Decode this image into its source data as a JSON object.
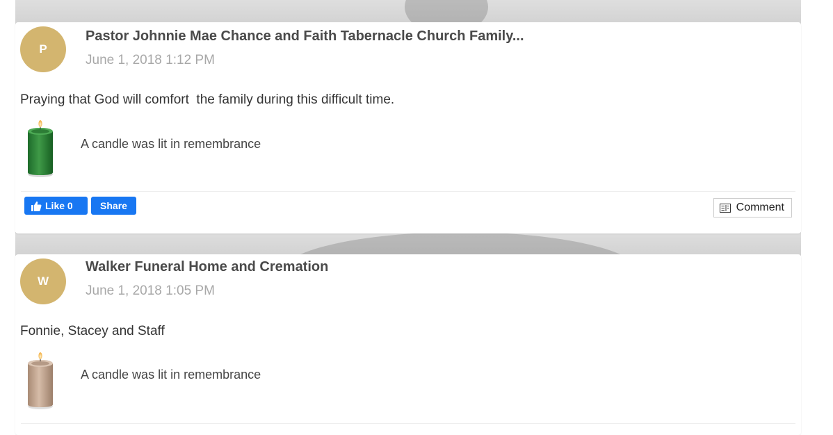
{
  "colors": {
    "avatar_bg": "#d3b56f",
    "facebook_blue": "#1877f2",
    "author_text": "#4a4a4a",
    "date_text": "#a8a8a8"
  },
  "posts": [
    {
      "avatar_initial": "P",
      "author": "Pastor Johnnie Mae Chance and Faith Tabernacle Church Family...",
      "date": "June 1, 2018 1:12 PM",
      "message": "Praying that God will comfort  the family during this difficult time.",
      "candle_color": "green",
      "candle_text": "A candle was lit in remembrance",
      "like_label": "Like 0",
      "share_label": "Share",
      "comment_label": "Comment"
    },
    {
      "avatar_initial": "W",
      "author": "Walker Funeral Home and Cremation",
      "date": "June 1, 2018 1:05 PM",
      "message": "Fonnie, Stacey and Staff",
      "candle_color": "beige",
      "candle_text": "A candle was lit in remembrance"
    }
  ],
  "icons": {
    "like": "thumbs-up-icon",
    "comment": "comment-icon",
    "candle": "candle-icon"
  }
}
